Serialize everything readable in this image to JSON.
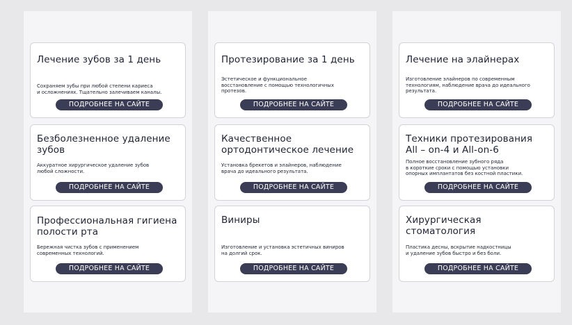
{
  "button_label": "ПОДРОБНЕЕ НА САЙТЕ",
  "colors": {
    "button_bg": "#3a3d55",
    "card_border": "#d2d3d9",
    "column_bg": "#f5f5f7",
    "page_bg": "#e8e8ea"
  },
  "columns": [
    {
      "cards": [
        {
          "title": "Лечение зубов за 1 день",
          "desc": "Сохраняем зубы при любой степени кариеса\nи осложнениях. Тщательно залечиваем каналы."
        },
        {
          "title": "Безболезненное удаление\nзубов",
          "desc": "Аккуратное хирургическое удаление зубов\nлюбой сложности."
        },
        {
          "title": "Профессиональная гигиена\nполости рта",
          "desc": "Бережная чистка зубов с применением\nсовременных технологий."
        }
      ]
    },
    {
      "cards": [
        {
          "title": "Протезирование за 1 день",
          "desc": "Эстетическое и функциональное\nвосстановление с помощью технологичных\nпротезов."
        },
        {
          "title": "Качественное\nортодонтическое лечение",
          "desc": "Установка брекетов и элайнеров, наблюдение\nврача до идеального результата."
        },
        {
          "title": "Виниры",
          "desc": "Изготовление и установка эстетичных виниров\nна долгий срок."
        }
      ]
    },
    {
      "cards": [
        {
          "title": "Лечение на элайнерах",
          "desc": "Изготовление элайнеров по современным\nтехнологиям, наблюдение врача до идеального\nрезультата."
        },
        {
          "title": "Техники протезирования\nAll – on-4 и All-on-6",
          "desc": "Полное восстановление зубного ряда\nв короткие сроки с помощью установки\nопорных имплантатов без костной пластики."
        },
        {
          "title": "Хирургическая\nстоматология",
          "desc": "Пластика десны, вскрытие надкостницы\nи удаление зубов быстро и без боли."
        }
      ]
    }
  ]
}
